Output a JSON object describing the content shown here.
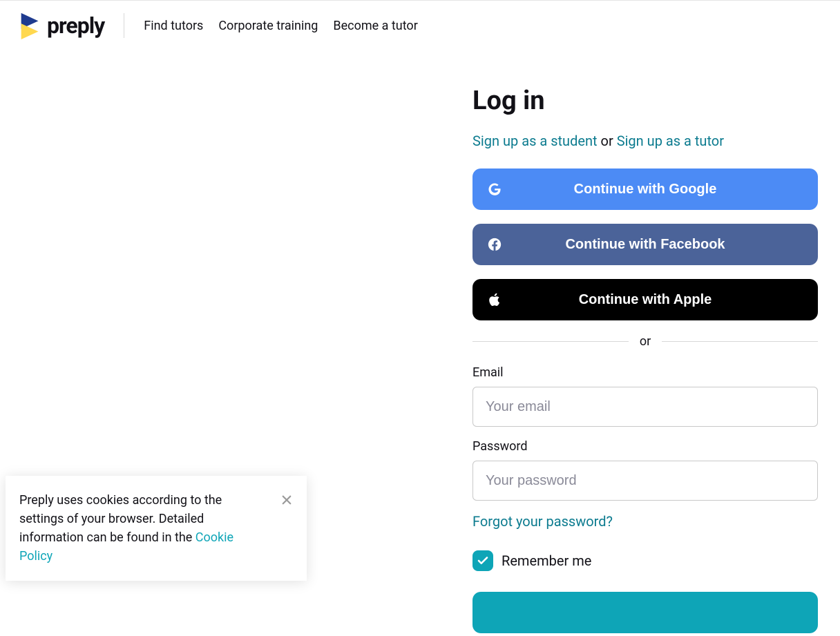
{
  "brand": {
    "name": "preply"
  },
  "nav": {
    "items": [
      {
        "label": "Find tutors"
      },
      {
        "label": "Corporate training"
      },
      {
        "label": "Become a tutor"
      }
    ]
  },
  "login": {
    "title": "Log in",
    "signup_student": "Sign up as a student",
    "or_word": "or",
    "signup_tutor": "Sign up as a tutor",
    "google_label": "Continue with Google",
    "facebook_label": "Continue with Facebook",
    "apple_label": "Continue with Apple",
    "divider": "or",
    "email_label": "Email",
    "email_placeholder": "Your email",
    "password_label": "Password",
    "password_placeholder": "Your password",
    "forgot_label": "Forgot your password?",
    "remember_label": "Remember me"
  },
  "cookie": {
    "text": "Preply uses cookies according to the settings of your browser. Detailed information can be found in the ",
    "link_label": "Cookie Policy"
  }
}
